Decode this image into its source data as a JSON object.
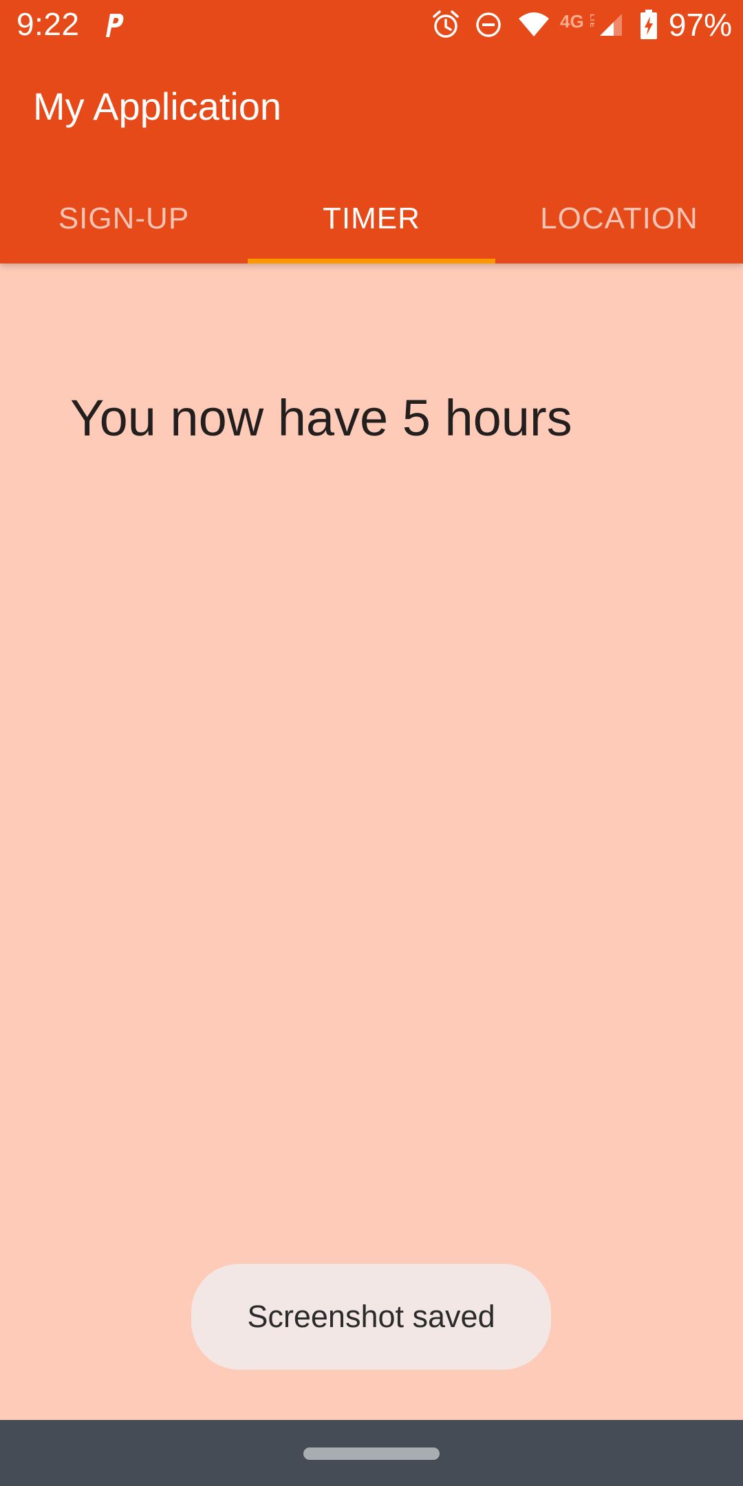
{
  "status_bar": {
    "time": "9:22",
    "battery_percent": "97%",
    "network_label": "4G LTE",
    "icons": [
      "parking-app-icon",
      "alarm-icon",
      "do-not-disturb-icon",
      "wifi-icon",
      "lte-icon",
      "signal-icon",
      "battery-charging-icon"
    ]
  },
  "app_bar": {
    "title": "My Application",
    "color": "#E64A19"
  },
  "tabs": [
    {
      "label": "SIGN-UP",
      "selected": false
    },
    {
      "label": "TIMER",
      "selected": true
    },
    {
      "label": "LOCATION",
      "selected": false
    }
  ],
  "tab_indicator_color": "#FF9800",
  "main": {
    "message": "You now have 5 hours",
    "background_color": "#FFCBB9"
  },
  "toast": {
    "text": "Screenshot saved"
  },
  "nav_bar": {
    "color": "#454C55"
  }
}
